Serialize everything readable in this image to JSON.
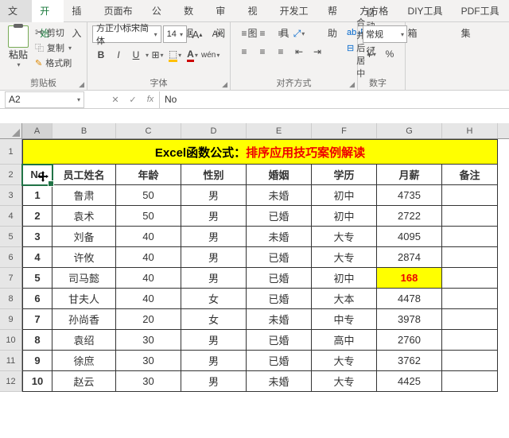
{
  "tabs": [
    "文件",
    "开始",
    "插入",
    "页面布局",
    "公式",
    "数据",
    "审阅",
    "视图",
    "开发工具",
    "帮助",
    "方方格子",
    "DIY工具箱",
    "PDF工具集"
  ],
  "activeTab": 1,
  "ribbon": {
    "clipboard": {
      "paste": "粘贴",
      "cut": "剪切",
      "copy": "复制",
      "format": "格式刷",
      "label": "剪贴板"
    },
    "font": {
      "name": "方正小标宋简体",
      "size": "14",
      "label": "字体",
      "b": "B",
      "i": "I",
      "u": "U"
    },
    "align": {
      "wrap": "自动换行",
      "merge": "合并后居中",
      "label": "对齐方式",
      "ab": "ab"
    },
    "number": {
      "general": "常规",
      "label": "数字"
    }
  },
  "namebox": "A2",
  "formula": "No",
  "fx": "fx",
  "cols": {
    "A": 38,
    "B": 80,
    "C": 82,
    "D": 82,
    "E": 82,
    "F": 82,
    "G": 82,
    "H": 70
  },
  "chart_data": {
    "type": "table",
    "title_black": "Excel函数公式：",
    "title_red": "排序应用技巧案例解读",
    "headers": [
      "No",
      "员工姓名",
      "年龄",
      "性别",
      "婚姻",
      "学历",
      "月薪",
      "备注"
    ],
    "rows": [
      [
        "1",
        "鲁肃",
        "50",
        "男",
        "未婚",
        "初中",
        "4735",
        ""
      ],
      [
        "2",
        "袁术",
        "50",
        "男",
        "已婚",
        "初中",
        "2722",
        ""
      ],
      [
        "3",
        "刘备",
        "40",
        "男",
        "未婚",
        "大专",
        "4095",
        ""
      ],
      [
        "4",
        "许攸",
        "40",
        "男",
        "已婚",
        "大专",
        "2874",
        ""
      ],
      [
        "5",
        "司马懿",
        "40",
        "男",
        "已婚",
        "初中",
        "168",
        ""
      ],
      [
        "6",
        "甘夫人",
        "40",
        "女",
        "已婚",
        "大本",
        "4478",
        ""
      ],
      [
        "7",
        "孙尚香",
        "20",
        "女",
        "未婚",
        "中专",
        "3978",
        ""
      ],
      [
        "8",
        "袁绍",
        "30",
        "男",
        "已婚",
        "高中",
        "2760",
        ""
      ],
      [
        "9",
        "徐庶",
        "30",
        "男",
        "已婚",
        "大专",
        "3762",
        ""
      ],
      [
        "10",
        "赵云",
        "30",
        "男",
        "未婚",
        "大专",
        "4425",
        ""
      ]
    ],
    "highlight": {
      "row": 4,
      "col": 6
    }
  }
}
